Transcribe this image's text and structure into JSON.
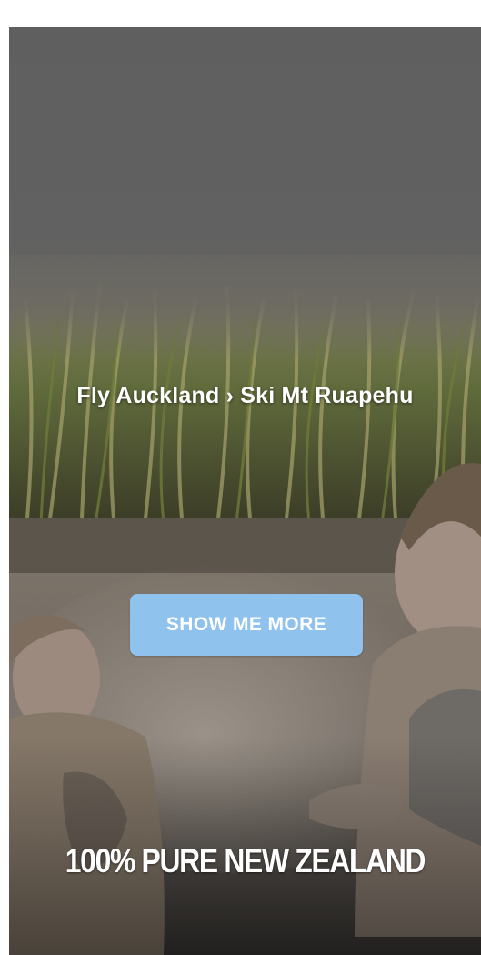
{
  "ad": {
    "headline": "Fly Auckland › Ski Mt Ruapehu",
    "cta_label": "SHOW ME MORE",
    "brand_text": "100% PURE NEW ZEALAND"
  },
  "colors": {
    "cta_background": "#8fc3ee",
    "overlay_gray": "#5f5f5f",
    "text": "#ffffff"
  },
  "icons": [
    "hero-photo-image"
  ]
}
